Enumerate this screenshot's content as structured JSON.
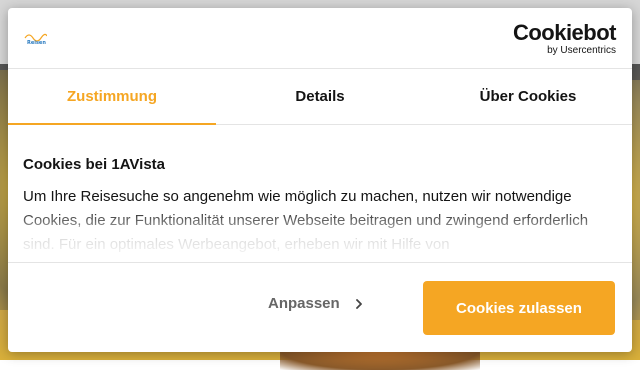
{
  "header": {
    "logo_icon": "1avista-reisen-logo",
    "brand_name": "Cookiebot",
    "brand_sub": "by Usercentrics"
  },
  "tabs": [
    {
      "label": "Zustimmung",
      "active": true
    },
    {
      "label": "Details",
      "active": false
    },
    {
      "label": "Über Cookies",
      "active": false
    }
  ],
  "content": {
    "title": "Cookies bei 1AVista",
    "body": "Um Ihre Reisesuche so angenehm wie möglich zu machen, nutzen wir notwendige Cookies, die zur Funktionalität unserer Webseite beitragen und zwingend erforderlich sind. Für ein optimales Werbeangebot, erheben wir mit Hilfe von"
  },
  "footer": {
    "customize_label": "Anpassen",
    "customize_icon": "chevron-right-icon",
    "allow_label": "Cookies zulassen"
  },
  "colors": {
    "accent": "#f5a623",
    "text": "#141414",
    "muted": "#666666"
  }
}
